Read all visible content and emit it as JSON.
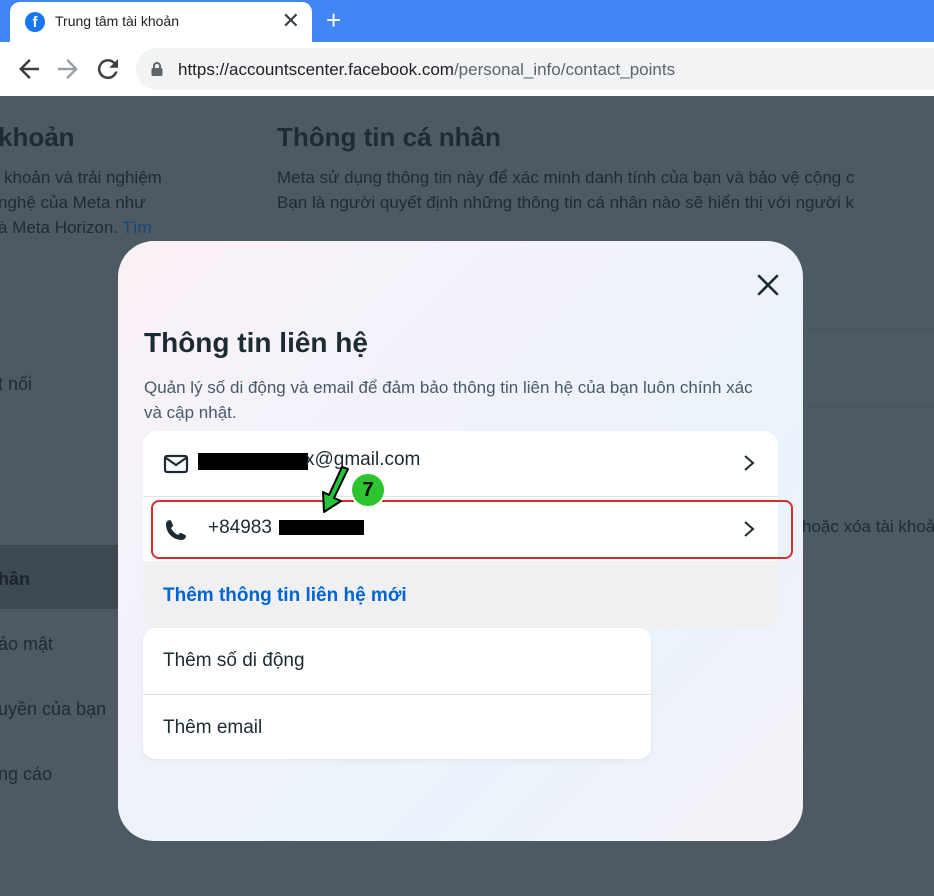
{
  "browser": {
    "tab_title": "Trung tâm tài khoản",
    "favicon_letter": "f",
    "tab_close": "✕",
    "new_tab": "+",
    "url_host": "https://accountscenter.facebook.com",
    "url_path": "/personal_info/contact_points"
  },
  "background": {
    "sidebar_heading": "khoản",
    "sidebar_desc_line1": "khoản và trải nghiệm",
    "sidebar_desc_line2": "nghệ của Meta như",
    "sidebar_desc_line3": "à Meta Horizon. ",
    "sidebar_link": "Tìm",
    "sidebar_item_connect": "t nối",
    "sidebar_item_personal": "hân",
    "sidebar_item_security": "ảo mật",
    "sidebar_item_rights": "uyền của bạn",
    "sidebar_item_ads": "ng cáo",
    "main_heading": "Thông tin cá nhân",
    "main_desc_line1": "Meta sử dụng thông tin này để xác minh danh tính của bạn và bảo vệ cộng c",
    "main_desc_line2": "Bạn là người quyết định những thông tin cá nhân nào sẽ hiển thị với người k",
    "main_right_text": "hoặc xóa tài khoả"
  },
  "modal": {
    "title": "Thông tin liên hệ",
    "description": "Quản lý số di động và email để đảm bảo thông tin liên hệ của bạn luôn chính xác và cập nhật.",
    "contacts": {
      "email_suffix": "x@gmail.com",
      "phone_prefix": "+84983"
    },
    "add_new_label": "Thêm thông tin liên hệ mới",
    "menu": {
      "add_phone": "Thêm số di động",
      "add_email": "Thêm email"
    }
  },
  "annotation": {
    "step_number": "7",
    "highlight_color": "#d32f2f",
    "badge_color": "#2ec42e"
  },
  "colors": {
    "accent_link": "#0064d1",
    "browser_blue": "#4285f4"
  }
}
